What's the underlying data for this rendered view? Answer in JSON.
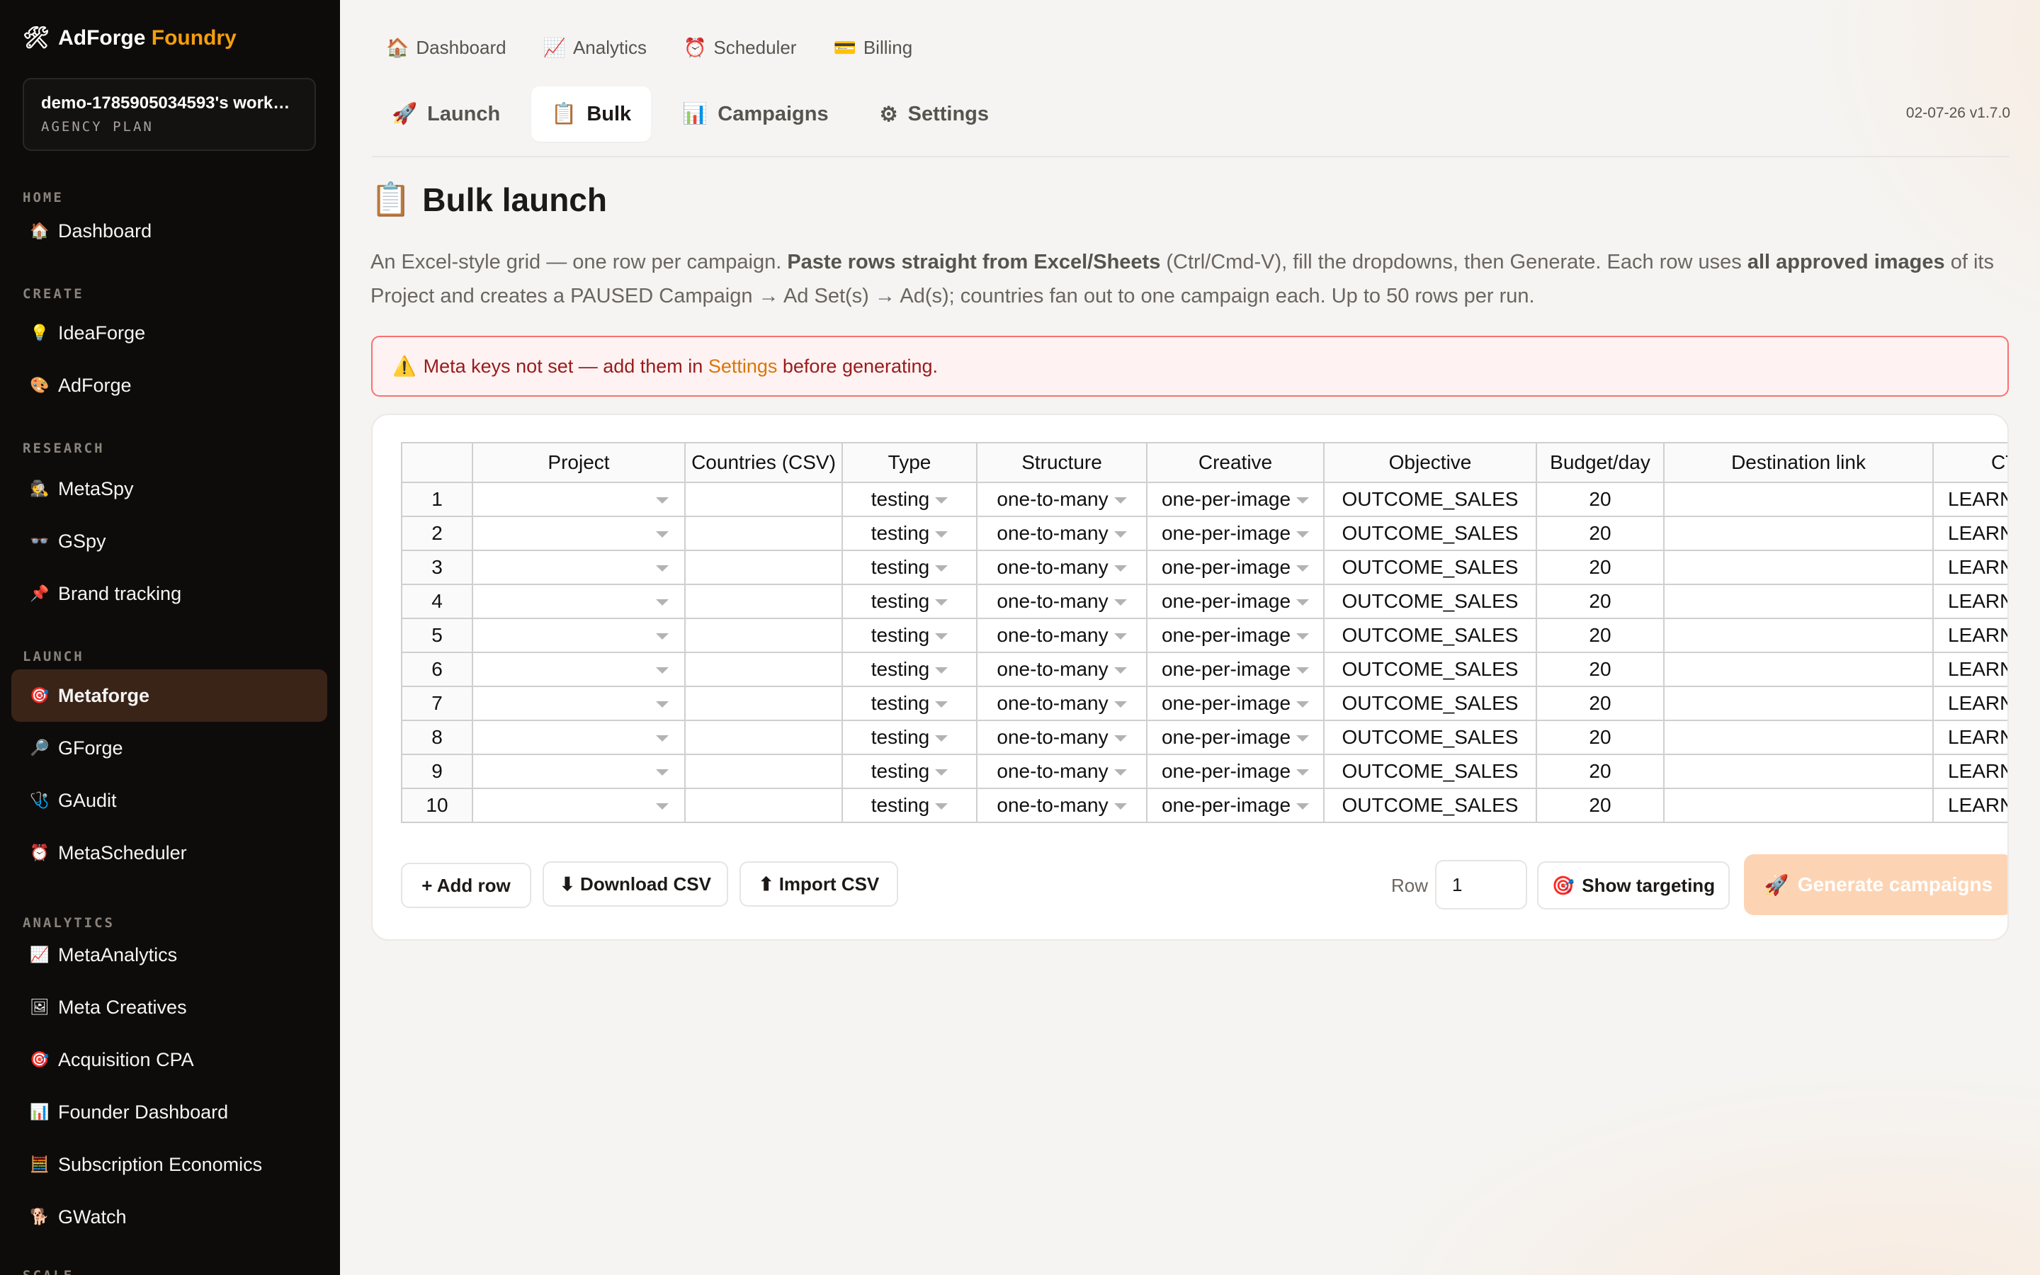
{
  "brand": {
    "icon": "🛠",
    "name": "AdForge",
    "accent": "Foundry"
  },
  "workspace": {
    "name": "demo-1785905034593's work…",
    "plan": "AGENCY PLAN"
  },
  "sidebar": {
    "sections": [
      {
        "label": "HOME",
        "items": [
          {
            "icon": "🏠",
            "label": "Dashboard"
          }
        ]
      },
      {
        "label": "CREATE",
        "items": [
          {
            "icon": "💡",
            "label": "IdeaForge"
          },
          {
            "icon": "🎨",
            "label": "AdForge"
          }
        ]
      },
      {
        "label": "RESEARCH",
        "items": [
          {
            "icon": "🕵",
            "label": "MetaSpy"
          },
          {
            "icon": "👓",
            "label": "GSpy"
          },
          {
            "icon": "📌",
            "label": "Brand tracking"
          }
        ]
      },
      {
        "label": "LAUNCH",
        "items": [
          {
            "icon": "🎯",
            "label": "Metaforge"
          },
          {
            "icon": "🔎",
            "label": "GForge"
          },
          {
            "icon": "🩺",
            "label": "GAudit"
          },
          {
            "icon": "⏰",
            "label": "MetaScheduler"
          }
        ]
      },
      {
        "label": "ANALYTICS",
        "items": [
          {
            "icon": "📈",
            "label": "MetaAnalytics"
          },
          {
            "icon": "🖼",
            "label": "Meta Creatives"
          },
          {
            "icon": "🎯",
            "label": "Acquisition CPA"
          },
          {
            "icon": "📊",
            "label": "Founder Dashboard"
          },
          {
            "icon": "🧮",
            "label": "Subscription Economics"
          },
          {
            "icon": "🐕",
            "label": "GWatch"
          }
        ]
      },
      {
        "label": "SCALE",
        "items": []
      }
    ]
  },
  "topnav": [
    {
      "icon": "🏠",
      "label": "Dashboard"
    },
    {
      "icon": "📈",
      "label": "Analytics"
    },
    {
      "icon": "⏰",
      "label": "Scheduler"
    },
    {
      "icon": "💳",
      "label": "Billing"
    }
  ],
  "tabs": [
    {
      "icon": "🚀",
      "label": "Launch"
    },
    {
      "icon": "📋",
      "label": "Bulk"
    },
    {
      "icon": "📊",
      "label": "Campaigns"
    },
    {
      "icon": "⚙",
      "label": "Settings"
    }
  ],
  "version": "02-07-26 v1.7.0",
  "page": {
    "title_icon": "📋",
    "title": "Bulk launch",
    "intro": {
      "p1": "An Excel-style grid — one row per campaign. ",
      "b1": "Paste rows straight from Excel/Sheets",
      "p2": " (Ctrl/Cmd-V), fill the dropdowns, then Generate. Each row uses ",
      "b2": "all approved images",
      "p3": " of its Project and creates a PAUSED Campaign → Ad Set(s) → Ad(s); countries fan out to one campaign each. Up to 50 rows per run."
    }
  },
  "alert": {
    "icon": "⚠️",
    "text_before": "Meta keys not set — add them in ",
    "link": "Settings",
    "text_after": " before generating."
  },
  "grid": {
    "columns": [
      "",
      "Project",
      "Countries (CSV)",
      "Type",
      "Structure",
      "Creative",
      "Objective",
      "Budget/day",
      "Destination link",
      "CTA"
    ],
    "rows": [
      {
        "n": "1",
        "project": "",
        "countries": "",
        "type": "testing",
        "structure": "one-to-many",
        "creative": "one-per-image",
        "objective": "OUTCOME_SALES",
        "budget": "20",
        "link": "",
        "cta": "LEARN_M"
      },
      {
        "n": "2",
        "project": "",
        "countries": "",
        "type": "testing",
        "structure": "one-to-many",
        "creative": "one-per-image",
        "objective": "OUTCOME_SALES",
        "budget": "20",
        "link": "",
        "cta": "LEARN_M"
      },
      {
        "n": "3",
        "project": "",
        "countries": "",
        "type": "testing",
        "structure": "one-to-many",
        "creative": "one-per-image",
        "objective": "OUTCOME_SALES",
        "budget": "20",
        "link": "",
        "cta": "LEARN_M"
      },
      {
        "n": "4",
        "project": "",
        "countries": "",
        "type": "testing",
        "structure": "one-to-many",
        "creative": "one-per-image",
        "objective": "OUTCOME_SALES",
        "budget": "20",
        "link": "",
        "cta": "LEARN_M"
      },
      {
        "n": "5",
        "project": "",
        "countries": "",
        "type": "testing",
        "structure": "one-to-many",
        "creative": "one-per-image",
        "objective": "OUTCOME_SALES",
        "budget": "20",
        "link": "",
        "cta": "LEARN_M"
      },
      {
        "n": "6",
        "project": "",
        "countries": "",
        "type": "testing",
        "structure": "one-to-many",
        "creative": "one-per-image",
        "objective": "OUTCOME_SALES",
        "budget": "20",
        "link": "",
        "cta": "LEARN_M"
      },
      {
        "n": "7",
        "project": "",
        "countries": "",
        "type": "testing",
        "structure": "one-to-many",
        "creative": "one-per-image",
        "objective": "OUTCOME_SALES",
        "budget": "20",
        "link": "",
        "cta": "LEARN_M"
      },
      {
        "n": "8",
        "project": "",
        "countries": "",
        "type": "testing",
        "structure": "one-to-many",
        "creative": "one-per-image",
        "objective": "OUTCOME_SALES",
        "budget": "20",
        "link": "",
        "cta": "LEARN_M"
      },
      {
        "n": "9",
        "project": "",
        "countries": "",
        "type": "testing",
        "structure": "one-to-many",
        "creative": "one-per-image",
        "objective": "OUTCOME_SALES",
        "budget": "20",
        "link": "",
        "cta": "LEARN_M"
      },
      {
        "n": "10",
        "project": "",
        "countries": "",
        "type": "testing",
        "structure": "one-to-many",
        "creative": "one-per-image",
        "objective": "OUTCOME_SALES",
        "budget": "20",
        "link": "",
        "cta": "LEARN_M"
      }
    ]
  },
  "actions": {
    "add_row": "+ Add row",
    "download_csv": "⬇ Download CSV",
    "import_csv": "⬆ Import CSV",
    "row_label": "Row",
    "row_value": "1",
    "show_targeting_icon": "🎯",
    "show_targeting": "Show targeting",
    "generate_icon": "🚀",
    "generate": "Generate campaigns"
  },
  "colors": {
    "accent": "#f59e0b",
    "active_nav": "#3a2418",
    "alert_border": "#f87171",
    "generate_disabled": "#fcd4b4"
  }
}
